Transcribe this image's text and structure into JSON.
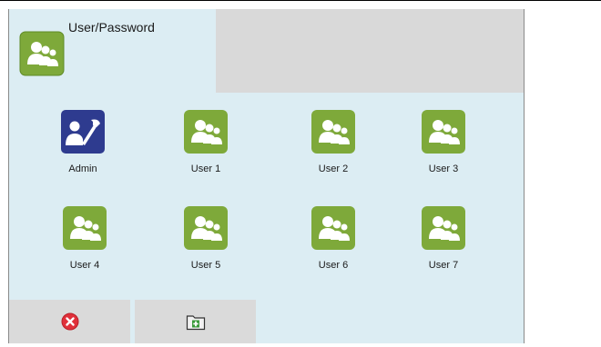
{
  "header": {
    "title": "User/Password",
    "icon": "users-icon"
  },
  "tiles": [
    {
      "label": "Admin",
      "icon": "admin-tools-icon"
    },
    {
      "label": "User 1",
      "icon": "users-icon"
    },
    {
      "label": "User 2",
      "icon": "users-icon"
    },
    {
      "label": "User 3",
      "icon": "users-icon"
    },
    {
      "label": "User 4",
      "icon": "users-icon"
    },
    {
      "label": "User 5",
      "icon": "users-icon"
    },
    {
      "label": "User 6",
      "icon": "users-icon"
    },
    {
      "label": "User 7",
      "icon": "users-icon"
    }
  ],
  "toolbar": {
    "close_icon": "close-circle-icon",
    "add_icon": "add-folder-icon"
  },
  "colors": {
    "user_green": "#7ea93a",
    "admin_blue": "#2e3b8f",
    "panel_blue": "#dcedf3",
    "button_gray": "#dadada",
    "close_red": "#e0303a"
  }
}
